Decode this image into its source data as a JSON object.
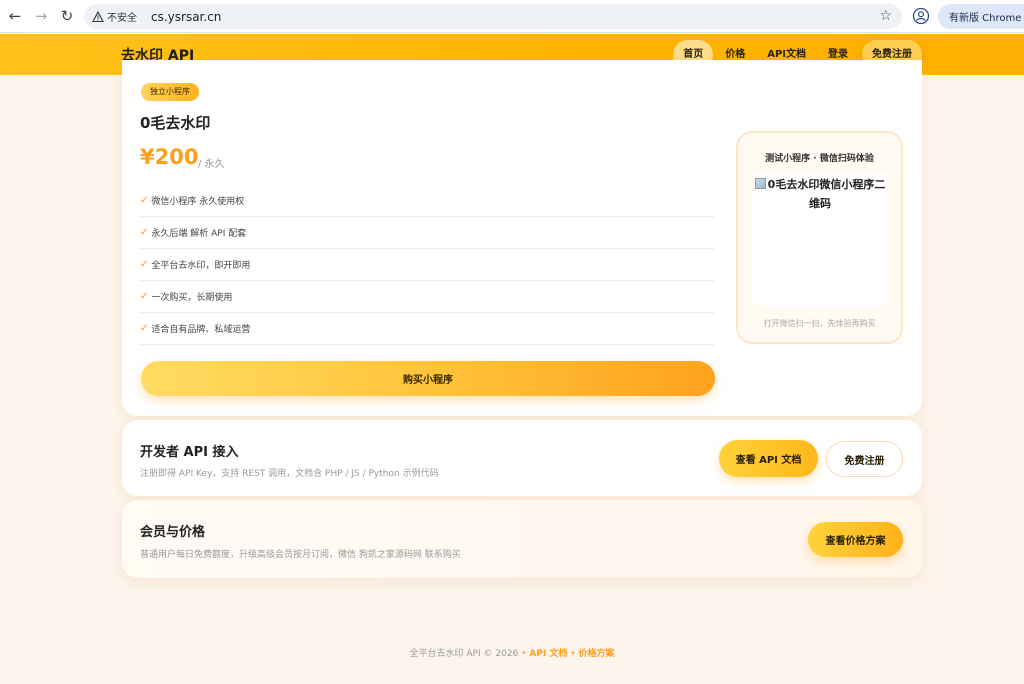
{
  "browser": {
    "security_label": "不安全",
    "url": "cs.ysrsar.cn",
    "update_label": "有新版 Chrome 可用"
  },
  "header": {
    "brand": "去水印 API",
    "nav": [
      "首页",
      "价格",
      "API文档",
      "登录",
      "免费注册"
    ]
  },
  "product": {
    "badge": "独立小程序",
    "title": "0毛去水印",
    "price": "¥200",
    "price_unit": "/ 永久",
    "features": [
      "微信小程序 永久使用权",
      "永久后端 解析 API 配套",
      "全平台去水印，即开即用",
      "一次购买，长期使用",
      "适合自有品牌、私域运营"
    ],
    "buy_label": "购买小程序",
    "check_mark": "✓",
    "qr": {
      "title": "测试小程序 · 微信扫码体验",
      "alt_text": "0毛去水印微信小程序二维码",
      "hint": "打开微信扫一扫，先体验再购买"
    }
  },
  "developer": {
    "title": "开发者 API 接入",
    "subtitle": "注册即得 API Key，支持 REST 调用，文档含 PHP / JS / Python 示例代码",
    "api_doc_label": "查看 API 文档",
    "signup_label": "免费注册"
  },
  "membership": {
    "title": "会员与价格",
    "subtitle": "普通用户每日免费额度，升级高级会员按月订阅，微信 狗凯之家源码网 联系购买",
    "pricing_label": "查看价格方案"
  },
  "footer": {
    "text": "全平台去水印 API © 2026",
    "separator": "•",
    "api_link": "API 文档",
    "pricing_link": "价格方案"
  },
  "colors": {
    "accent": "#ffb300",
    "price": "#ff9f1a",
    "background": "#fdf4ec"
  }
}
